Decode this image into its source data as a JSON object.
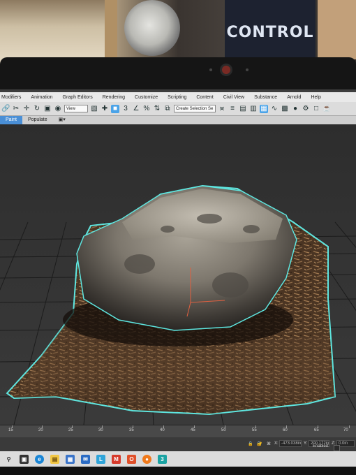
{
  "room": {
    "poster_title": "CONTROL"
  },
  "menubar": {
    "items": [
      "Modifiers",
      "Animation",
      "Graph Editors",
      "Rendering",
      "Customize",
      "Scripting",
      "Content",
      "Civil View",
      "Substance",
      "Arnold",
      "Help"
    ]
  },
  "toolbar": {
    "view_dropdown": "View",
    "selection_set_dropdown": "Create Selection Se"
  },
  "ribbon": {
    "tabs": [
      "Paint",
      "Populate"
    ]
  },
  "ruler": {
    "labels": [
      "15",
      "20",
      "25",
      "30",
      "35",
      "40",
      "45",
      "50",
      "55",
      "60",
      "65",
      "70"
    ]
  },
  "status": {
    "x_label": "X:",
    "x_value": "-473.038in",
    "y_label": "Y:",
    "y_value": "200.172in",
    "z_label": "Z:",
    "z_value": "0.0in",
    "enabled_label": "Enabled:"
  },
  "taskbar": {
    "icons": [
      "search-icon",
      "taskview-icon",
      "edge-icon",
      "explorer-icon",
      "store-icon",
      "mail-icon",
      "l-app-icon",
      "mcafee-icon",
      "office-icon",
      "firefox-icon",
      "3dsmax-icon"
    ]
  },
  "colors": {
    "selection_outline": "#5ee6e0",
    "active_tool": "#4aa3e8",
    "viewport_bg": "#333333"
  }
}
